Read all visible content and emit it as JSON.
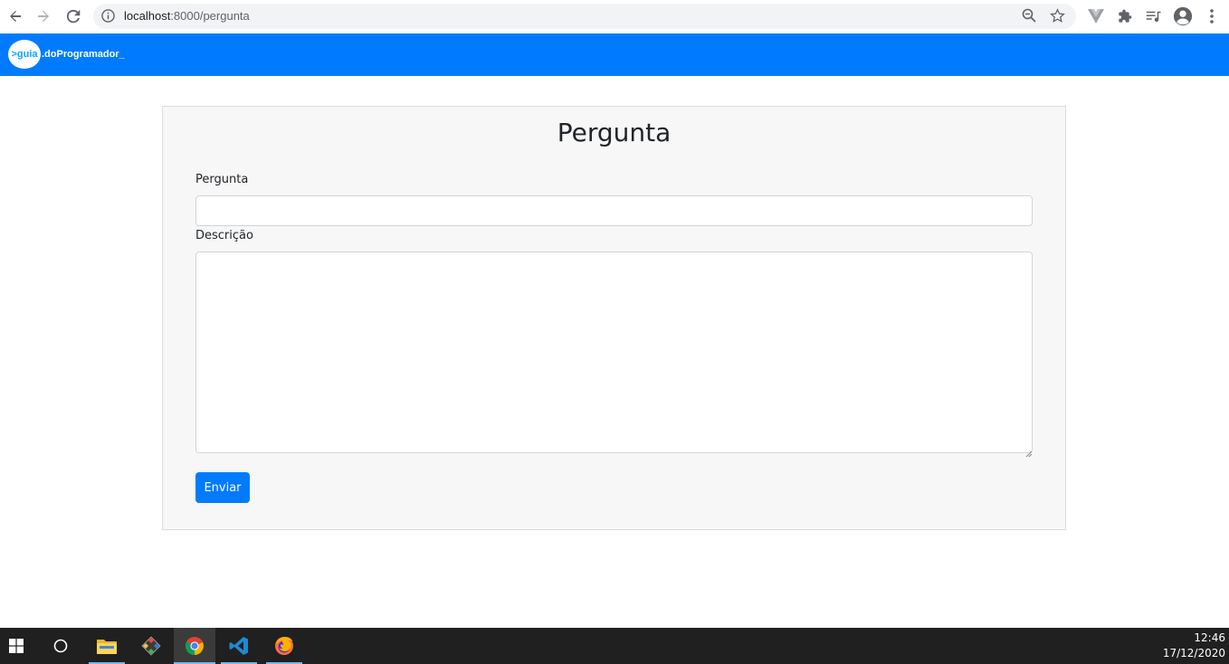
{
  "browser": {
    "url_host": "localhost",
    "url_path": ":8000/pergunta",
    "icons": [
      "back-icon",
      "forward-icon",
      "reload-icon",
      "info-icon",
      "zoom-icon",
      "star-icon",
      "vue-devtools-icon",
      "extensions-icon",
      "media-icon",
      "profile-icon",
      "menu-icon"
    ]
  },
  "navbar": {
    "brand_circle": ">guia",
    "brand_text": ".doProgramador_",
    "color": "#007bff"
  },
  "form": {
    "title": "Pergunta",
    "question_label": "Pergunta",
    "question_value": "",
    "description_label": "Descrição",
    "description_value": "",
    "submit_label": "Enviar"
  },
  "taskbar": {
    "apps": [
      "windows-start-icon",
      "search-circle-icon",
      "file-explorer-icon",
      "git-icon",
      "chrome-icon",
      "vscode-icon",
      "firefox-icon"
    ],
    "time": "12:46",
    "date": "17/12/2020"
  }
}
